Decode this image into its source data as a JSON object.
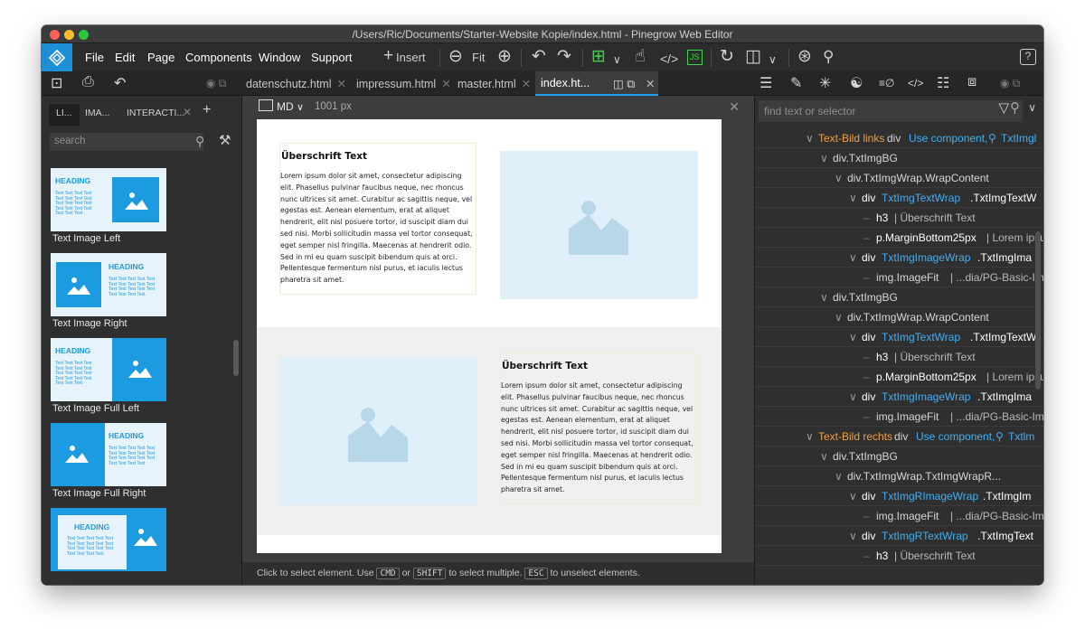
{
  "window": {
    "title": "/Users/Ric/Documents/Starter-Website Kopie/index.html - Pinegrow Web Editor"
  },
  "menu": {
    "file": "File",
    "edit": "Edit",
    "page": "Page",
    "components": "Components",
    "window": "Window",
    "support": "Support"
  },
  "toolbar": {
    "insert": "Insert",
    "fit": "Fit",
    "js": "JS"
  },
  "tabs": {
    "t1": "datenschutz.html",
    "t2": "impressum.html",
    "t3": "master.html",
    "active": "index.ht..."
  },
  "left_panel": {
    "tabs": {
      "lib": "LI...",
      "ima": "IMA...",
      "interact": "INTERACTI..."
    },
    "search_placeholder": "search",
    "thumb_heading": "HEADING",
    "thumb_text": "Text Text Text Text Text Text Text Text Text Text Text Text Text Text Text Text Text Text Text",
    "items": {
      "i1": "Text Image Left",
      "i2": "Text Image Right",
      "i3": "Text Image Full Left",
      "i4": "Text Image Full Right"
    }
  },
  "canvas": {
    "device": "MD",
    "width": "1001 px",
    "heading": "Überschrift Text",
    "body": "Lorem ipsum dolor sit amet, consectetur adipiscing elit. Phasellus pulvinar faucibus neque, nec rhoncus nunc ultrices sit amet. Curabitur ac sagittis neque, vel egestas est. Aenean elementum, erat at aliquet hendrerit, elit nisl posuere tortor, id suscipit diam dui sed nisi. Morbi sollicitudin massa vel tortor consequat, eget semper nisl fringilla. Maecenas at hendrerit odio. Sed in mi eu quam suscipit bibendum quis at orci. Pellentesque fermentum nisl purus, et iaculis lectus pharetra sit amet."
  },
  "status": {
    "part1": "Click to select element. Use",
    "cmd": "CMD",
    "or": "or",
    "shift": "SHIFT",
    "part2": "to select multiple.",
    "esc": "ESC",
    "part3": "to unselect elements."
  },
  "right_panel": {
    "search_placeholder": "find text or selector",
    "tree": {
      "r1_name": "Text-Bild links",
      "r1_tag": "div",
      "r1_comp": "Use component,",
      "r1_class": "TxtImgl",
      "r2": "div.TxtImgBG",
      "r3": "div.TxtImgWrap.WrapContent",
      "r4_tag": "div",
      "r4_link": "TxtImgTextWrap",
      "r4_rest": ".TxtImgTextW",
      "r5_tag": "h3",
      "r5_text": "| Überschrift Text",
      "r6_tag": "p.MarginBottom25px",
      "r6_text": "| Lorem ipsu",
      "r7_tag": "div",
      "r7_link": "TxtImgImageWrap",
      "r7_rest": ".TxtImgIma",
      "r8_tag": "img.ImageFit",
      "r8_text": "| ...dia/PG-Basic-Img",
      "r9": "div.TxtImgBG",
      "r10": "div.TxtImgWrap.WrapContent",
      "r11_tag": "div",
      "r11_link": "TxtImgTextWrap",
      "r11_rest": ".TxtImgTextW",
      "r12_tag": "h3",
      "r12_text": "| Überschrift Text",
      "r13_tag": "p.MarginBottom25px",
      "r13_text": "| Lorem ipsu",
      "r14_tag": "div",
      "r14_link": "TxtImgImageWrap",
      "r14_rest": ".TxtImgIma",
      "r15_tag": "img.ImageFit",
      "r15_text": "| ...dia/PG-Basic-Img",
      "r16_name": "Text-Bild rechts",
      "r16_tag": "div",
      "r16_comp": "Use component,",
      "r16_class": "Txtlm",
      "r17": "div.TxtImgBG",
      "r18": "div.TxtImgWrap.TxtImgWrapR...",
      "r19_tag": "div",
      "r19_link": "TxtImgRImageWrap",
      "r19_rest": ".TxtImgIm",
      "r20_tag": "img.ImageFit",
      "r20_text": "| ...dia/PG-Basic-Img",
      "r21_tag": "div",
      "r21_link": "TxtImgRTextWrap",
      "r21_rest": ".TxtImgText",
      "r22_tag": "h3",
      "r22_text": "| Überschrift Text"
    }
  }
}
